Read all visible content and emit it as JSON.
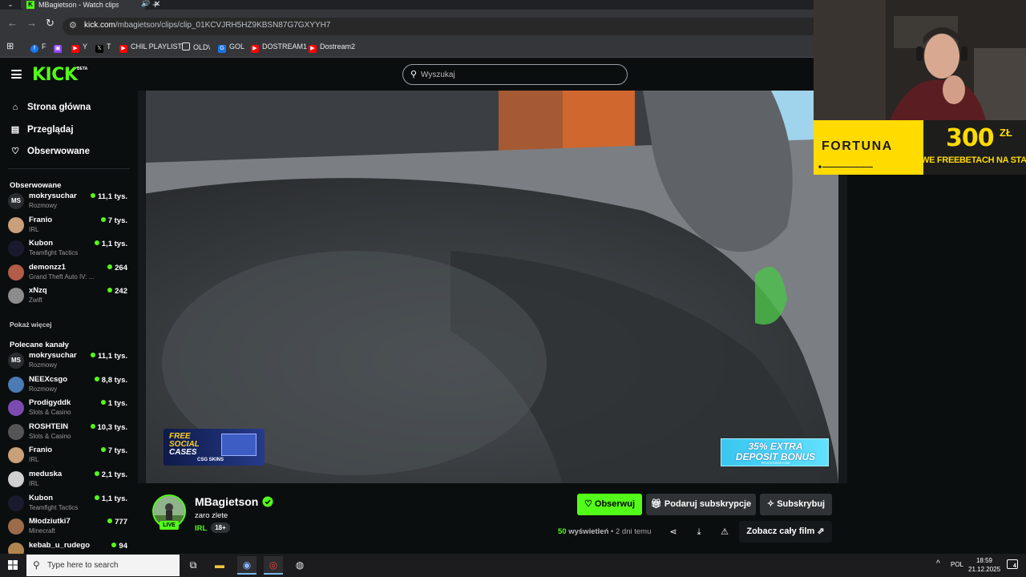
{
  "browser": {
    "tab_title": "MBagietson - Watch clips o",
    "url_host": "kick.com",
    "url_path": "/mbagietson/clips/clip_01KCVJRH5HZ9KBSN87G7GXYYH7",
    "bookmarks": [
      {
        "label": "F",
        "icon": "facebook-icon",
        "color": "#1877f2"
      },
      {
        "label": "",
        "icon": "twitch-icon",
        "color": "#9146ff"
      },
      {
        "label": "Y",
        "icon": "youtube-icon",
        "color": "#ff0000"
      },
      {
        "label": "T",
        "icon": "x-icon",
        "color": "#000000"
      },
      {
        "label": "CHIL PLAYLIST",
        "icon": "youtube-icon",
        "color": "#ff0000"
      },
      {
        "label": "OLD\\",
        "icon": "folder-icon",
        "color": "#35363a"
      },
      {
        "label": "GOL",
        "icon": "gol-icon",
        "color": "#1a73e8"
      },
      {
        "label": "DOSTREAM1",
        "icon": "youtube-icon",
        "color": "#ff0000"
      },
      {
        "label": "Dostream2",
        "icon": "youtube-icon",
        "color": "#ff0000"
      }
    ]
  },
  "header": {
    "logo": "KICK",
    "beta": "BETA",
    "search_placeholder": "Wyszukaj"
  },
  "sidebar": {
    "nav": [
      {
        "label": "Strona główna",
        "icon": "home-icon"
      },
      {
        "label": "Przeglądaj",
        "icon": "browse-icon"
      },
      {
        "label": "Obserwowane",
        "icon": "heart-icon"
      }
    ],
    "followed_title": "Obserwowane",
    "followed": [
      {
        "name": "mokrysuchar",
        "category": "Rozmowy",
        "viewers": "11,1 tys.",
        "avatar": "MS",
        "color": "#2a2d30"
      },
      {
        "name": "Franio",
        "category": "IRL",
        "viewers": "7 tys.",
        "avatar": "",
        "color": "#c9a07a"
      },
      {
        "name": "Kubon",
        "category": "Teamfight Tactics",
        "viewers": "1,1 tys.",
        "avatar": "",
        "color": "#1a1a2e"
      },
      {
        "name": "demonzz1",
        "category": "Grand Theft Auto IV: ...",
        "viewers": "264",
        "avatar": "",
        "color": "#b25c4a"
      },
      {
        "name": "xNzq",
        "category": "Zwift",
        "viewers": "242",
        "avatar": "",
        "color": "#8c8c8c"
      }
    ],
    "show_more": "Pokaż więcej",
    "recommended_title": "Polecane kanały",
    "recommended": [
      {
        "name": "mokrysuchar",
        "category": "Rozmowy",
        "viewers": "11,1 tys.",
        "avatar": "MS",
        "color": "#2a2d30"
      },
      {
        "name": "NEEXcsgo",
        "category": "Rozmowy",
        "viewers": "8,8 tys.",
        "avatar": "",
        "color": "#4a7bb5"
      },
      {
        "name": "Prodigyddk",
        "category": "Slots & Casino",
        "viewers": "1 tys.",
        "avatar": "",
        "color": "#7b4bb0"
      },
      {
        "name": "ROSHTEIN",
        "category": "Slots & Casino",
        "viewers": "10,3 tys.",
        "avatar": "",
        "color": "#555555"
      },
      {
        "name": "Franio",
        "category": "IRL",
        "viewers": "7 tys.",
        "avatar": "",
        "color": "#c9a07a"
      },
      {
        "name": "meduska",
        "category": "IRL",
        "viewers": "2,1 tys.",
        "avatar": "",
        "color": "#d0d0d0"
      },
      {
        "name": "Kubon",
        "category": "Teamfight Tactics",
        "viewers": "1,1 tys.",
        "avatar": "",
        "color": "#1a1a2e"
      },
      {
        "name": "Młodziutki7",
        "category": "Minecraft",
        "viewers": "777",
        "avatar": "",
        "color": "#9c6b4a"
      },
      {
        "name": "kebab_u_rudego",
        "category": "",
        "viewers": "94",
        "avatar": "",
        "color": "#b0854f"
      }
    ]
  },
  "video": {
    "ad_left_line1": "FREE",
    "ad_left_line2": "SOCIAL",
    "ad_left_line3": "CASES",
    "ad_left_sub": "CSG SKINS",
    "ad_right_line1": "35% EXTRA",
    "ad_right_line2": "DEPOSIT BONUS",
    "ad_right_sub": "PIRATESWAP.COM"
  },
  "channel": {
    "name": "MBagietson",
    "clip_title": "zaro zlete",
    "category": "IRL",
    "age_badge": "18+",
    "live_badge": "LIVE",
    "follow_label": "Obserwuj",
    "gift_label": "Podaruj subskrypcje",
    "subscribe_label": "Subskrybuj",
    "views_count": "50",
    "views_label": "wyświetleń",
    "time_ago": "• 2 dni temu",
    "full_film_label": "Zobacz cały film"
  },
  "overlay": {
    "fortuna_brand": "FORTUNA",
    "fortuna_amount": "300",
    "fortuna_currency": "ZŁ",
    "fortuna_promo": "WE FREEBETACH NA START",
    "fortuna_brand_color": "#ffdb00"
  },
  "taskbar": {
    "search_placeholder": "Type here to search",
    "lang": "POL",
    "time": "18:59",
    "date": "21.12.2025",
    "notifications": "4"
  },
  "colors": {
    "kick_green": "#53fc18",
    "background": "#0b0e0f"
  }
}
